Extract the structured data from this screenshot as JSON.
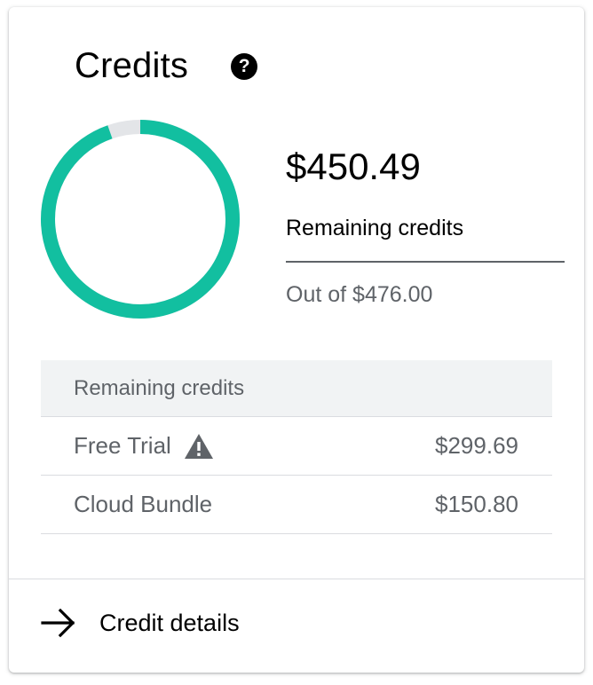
{
  "card": {
    "title": "Credits",
    "help_icon": "help-circle-icon"
  },
  "summary": {
    "remaining_amount": "$450.49",
    "remaining_label": "Remaining credits",
    "out_of": "Out of $476.00",
    "remaining_fraction": 0.9464
  },
  "colors": {
    "remaining": "#12bfa0",
    "used": "#e3e5e8"
  },
  "table": {
    "header": "Remaining credits",
    "rows": [
      {
        "name": "Free Trial",
        "amount": "$299.69",
        "icon": "warning-icon"
      },
      {
        "name": "Cloud Bundle",
        "amount": "$150.80"
      }
    ]
  },
  "footer": {
    "link_label": "Credit details",
    "icon": "arrow-right-icon"
  }
}
